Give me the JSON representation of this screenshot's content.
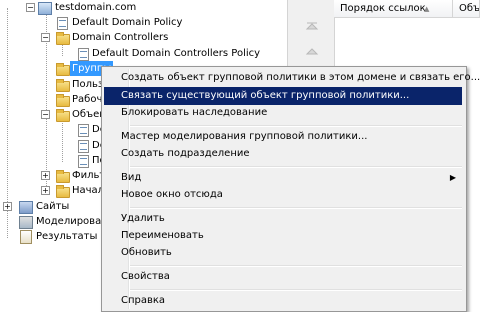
{
  "tree": {
    "items": [
      {
        "label": "testdomain.com"
      },
      {
        "label": "Default Domain Policy"
      },
      {
        "label": "Domain Controllers"
      },
      {
        "label": "Default Domain Controllers Policy"
      },
      {
        "label": "Группы"
      },
      {
        "label": "Польз"
      },
      {
        "label": "Рабоч"
      },
      {
        "label": "Объек"
      },
      {
        "label": "De"
      },
      {
        "label": "De"
      },
      {
        "label": "По"
      },
      {
        "label": "Фильт"
      },
      {
        "label": "Начал"
      },
      {
        "label": "Сайты"
      },
      {
        "label": "Моделирован"
      },
      {
        "label": "Результаты г"
      }
    ],
    "expand_minus": "−",
    "expand_plus": "+"
  },
  "list": {
    "columns": [
      {
        "label": "Порядок ссылок"
      },
      {
        "label": "Объе"
      }
    ],
    "sort_indicator": "▲"
  },
  "context_menu": {
    "items": [
      {
        "label": "Создать объект групповой политики в этом домене и связать его..."
      },
      {
        "label": "Связать существующий объект групповой политики...",
        "highlighted": true
      },
      {
        "label": "Блокировать наследование"
      },
      {
        "label": "Мастер моделирования групповой политики..."
      },
      {
        "label": "Создать подразделение"
      },
      {
        "label": "Вид",
        "submenu": true
      },
      {
        "label": "Новое окно отсюда"
      },
      {
        "label": "Удалить"
      },
      {
        "label": "Переименовать"
      },
      {
        "label": "Обновить"
      },
      {
        "label": "Свойства"
      },
      {
        "label": "Справка"
      }
    ],
    "submenu_arrow": "▶"
  },
  "colors": {
    "menu_highlight": "#0a246a",
    "tree_selection": "#3399ff"
  }
}
